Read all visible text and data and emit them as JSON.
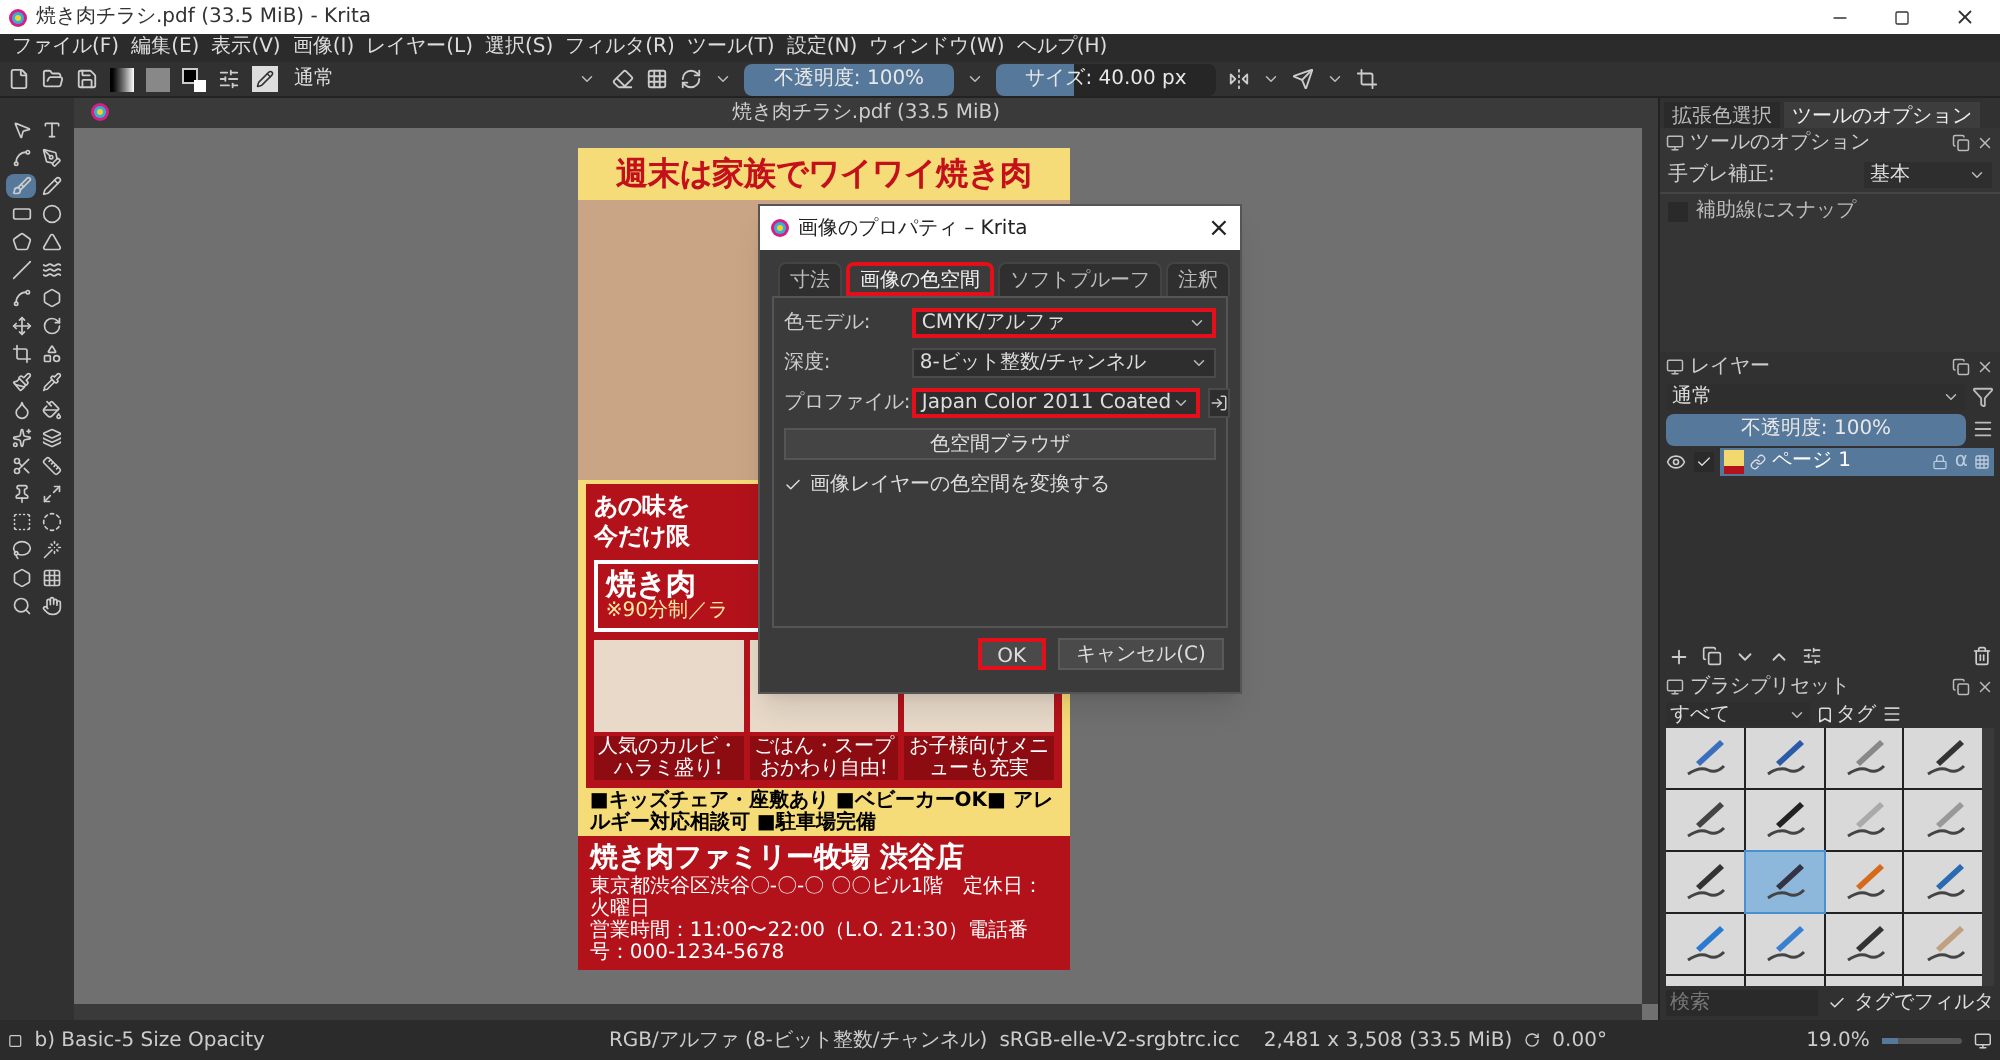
{
  "window": {
    "title": "焼き肉チラシ.pdf (33.5 MiB)  - Krita"
  },
  "menu": [
    "ファイル(F)",
    "編集(E)",
    "表示(V)",
    "画像(I)",
    "レイヤー(L)",
    "選択(S)",
    "フィルタ(R)",
    "ツール(T)",
    "設定(N)",
    "ウィンドウ(W)",
    "ヘルプ(H)"
  ],
  "toolbar": {
    "blend_mode": "通常",
    "opacity": {
      "label": "不透明度: 100%",
      "level": 1.0
    },
    "size": {
      "label": "サイズ: 40.00 px",
      "level": 0.35
    }
  },
  "tools": [
    {
      "selected": false
    },
    {
      "selected": false
    },
    {
      "selected": false
    },
    {
      "selected": false
    },
    {
      "selected": true
    },
    {
      "selected": false
    },
    {
      "selected": false
    },
    {
      "selected": false
    },
    {
      "selected": false
    },
    {
      "selected": false
    },
    {
      "selected": false
    },
    {
      "selected": false
    },
    {
      "selected": false
    },
    {
      "selected": false
    },
    {
      "selected": false
    },
    {
      "selected": false
    },
    {
      "selected": false
    },
    {
      "selected": false
    },
    {
      "selected": false
    },
    {
      "selected": false
    },
    {
      "selected": false
    },
    {
      "selected": false
    },
    {
      "selected": false
    },
    {
      "selected": false
    },
    {
      "selected": false
    },
    {
      "selected": false
    },
    {
      "selected": false
    },
    {
      "selected": false
    },
    {
      "selected": false
    },
    {
      "selected": false
    },
    {
      "selected": false
    },
    {
      "selected": false
    },
    {
      "selected": false
    },
    {
      "selected": false
    },
    {
      "selected": false
    },
    {
      "selected": false
    }
  ],
  "document_tab": "焼き肉チラシ.pdf (33.5 MiB)",
  "flyer": {
    "headline": "週末は家族でワイワイ焼き肉",
    "promo_lines": [
      "あの味を",
      "今だけ限"
    ],
    "offer_title": "焼き肉",
    "offer_note": "※90分制／ラ",
    "captions": [
      "人気のカルビ・ハラミ盛り!",
      "ごはん・スープおかわり自由!",
      "お子様向けメニューも充実"
    ],
    "features": "■キッズチェア・座敷あり ■ベビーカーOK■ アレルギー対応相談可 ■駐車場完備",
    "store_name": "焼き肉ファミリー牧場 渋谷店",
    "address": "東京都渋谷区渋谷〇-〇-〇 〇〇ビル1階　定休日：火曜日",
    "hours": "営業時間：11:00〜22:00（L.O. 21:30）電話番号：000-1234-5678"
  },
  "dialog": {
    "title": "画像のプロパティ – Krita",
    "close": "×",
    "tabs": [
      {
        "label": "寸法",
        "selected": false,
        "highlighted": false
      },
      {
        "label": "画像の色空間",
        "selected": true,
        "highlighted": true
      },
      {
        "label": "ソフトプルーフ",
        "selected": false,
        "highlighted": false
      },
      {
        "label": "注釈",
        "selected": false,
        "highlighted": false
      }
    ],
    "fields": [
      {
        "label": "色モデル:",
        "value": "CMYK/アルファ",
        "highlighted": true,
        "has_button": false
      },
      {
        "label": "深度:",
        "value": "8-ビット整数/チャンネル",
        "highlighted": false,
        "has_button": false
      },
      {
        "label": "プロファイル:",
        "value": "Japan Color 2011 Coated",
        "highlighted": true,
        "has_button": true
      }
    ],
    "browser_button": "色空間ブラウザ",
    "convert_checkbox": {
      "label": "画像レイヤーの色空間を変換する",
      "checked": true
    },
    "buttons": [
      {
        "label": "OK",
        "highlighted": true
      },
      {
        "label": "キャンセル(C)",
        "highlighted": false
      }
    ]
  },
  "dock_tabs": [
    {
      "label": "拡張色選択",
      "selected": false
    },
    {
      "label": "ツールのオプション",
      "selected": true
    }
  ],
  "tool_options": {
    "title": "ツールのオプション",
    "stabilizer_label": "手ブレ補正:",
    "stabilizer_value": "基本",
    "snap": {
      "label": "補助線にスナップ",
      "checked": false
    }
  },
  "layers": {
    "title": "レイヤー",
    "blend_mode": "通常",
    "opacity": {
      "label": "不透明度: 100%",
      "level": 1.0
    },
    "items": [
      {
        "name": "ページ 1",
        "visible": true,
        "checked": true,
        "selected": true,
        "alpha_symbol": "α"
      }
    ]
  },
  "brush_presets": {
    "title": "ブラシプリセット",
    "filter": "すべて",
    "tag_label": "タグ",
    "search_placeholder": "検索",
    "tag_filter": {
      "label": "タグでフィルタ",
      "checked": true
    },
    "items": [
      {
        "selected": false
      },
      {
        "selected": false
      },
      {
        "selected": false
      },
      {
        "selected": false
      },
      {
        "selected": false
      },
      {
        "selected": false
      },
      {
        "selected": false
      },
      {
        "selected": false
      },
      {
        "selected": false
      },
      {
        "selected": true
      },
      {
        "selected": false
      },
      {
        "selected": false
      },
      {
        "selected": false
      },
      {
        "selected": false
      },
      {
        "selected": false
      },
      {
        "selected": false
      },
      {
        "selected": false
      },
      {
        "selected": false
      },
      {
        "selected": false
      },
      {
        "selected": false
      }
    ]
  },
  "status_bar": {
    "preset": "b) Basic-5 Size Opacity",
    "color_space": "RGB/アルファ (8-ビット整数/チャンネル)",
    "profile": "sRGB-elle-V2-srgbtrc.icc",
    "dimensions": "2,481 x 3,508 (33.5 MiB)",
    "rotation": "0.00°",
    "zoom": "19.0%",
    "zoom_level": {
      "level": 0.2
    }
  }
}
